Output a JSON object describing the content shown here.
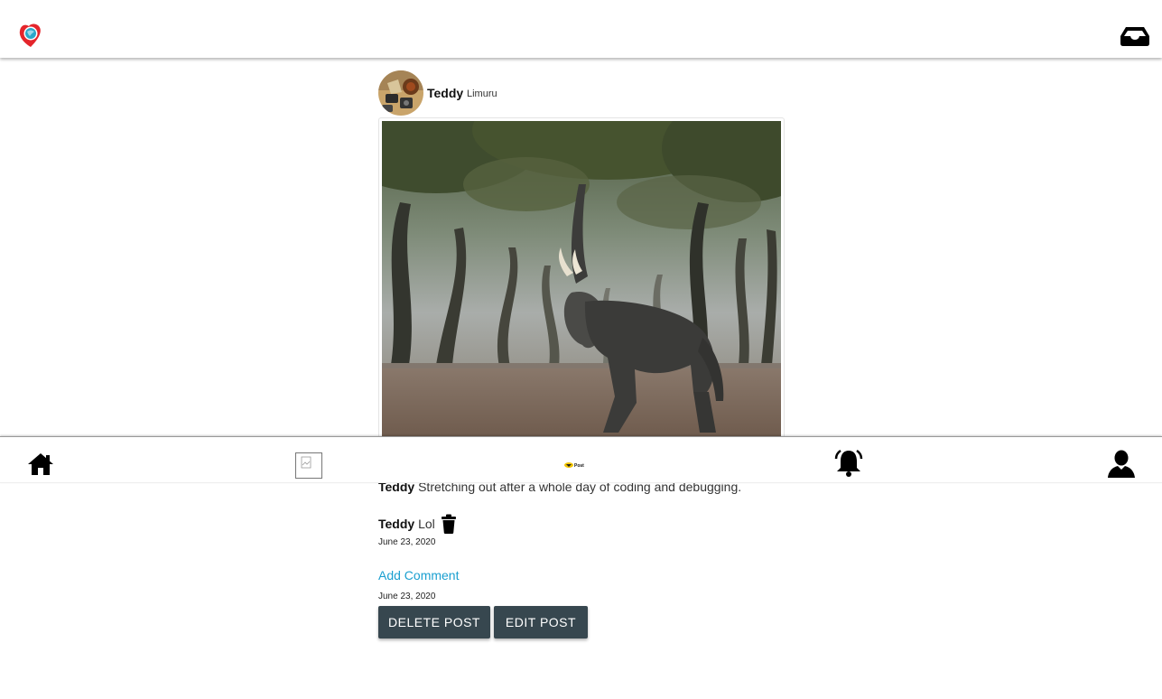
{
  "header": {
    "logo_icon": "app-logo-icon",
    "inbox_icon": "inbox-icon"
  },
  "post": {
    "username": "Teddy",
    "location": "Limuru",
    "caption_user": "Teddy",
    "caption_text": "Stretching out after a whole day of coding and debugging.",
    "comments": [
      {
        "user": "Teddy",
        "text": "Lol",
        "date": "June 23, 2020"
      }
    ],
    "add_comment_label": "Add Comment",
    "post_date": "June 23, 2020",
    "delete_label": "DELETE POST",
    "edit_label": "EDIT POST"
  },
  "bottom_nav": {
    "post_logo_text": "Post",
    "items": [
      "home-icon",
      "broken-image-icon",
      "post-logo-icon",
      "notification-bell-icon",
      "profile-icon"
    ]
  },
  "colors": {
    "button_bg": "#37474f",
    "link": "#1a9fd0",
    "logo_red": "#e4252b",
    "logo_teal": "#2aa7c9"
  }
}
